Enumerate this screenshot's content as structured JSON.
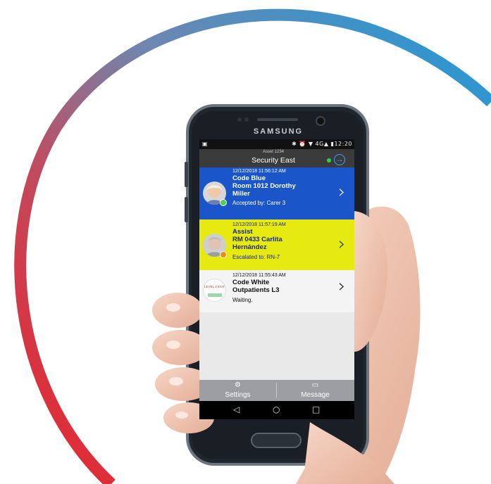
{
  "phone": {
    "brand": "SAMSUNG"
  },
  "status_bar": {
    "left_icon": "image-notification-icon",
    "right_text": "✱ ⏰ ▼ 4G▲ ▮12:20",
    "time": "12:20"
  },
  "app_bar": {
    "asset": "Asset 1234",
    "title": "Security East",
    "online_color": "#2dd34a"
  },
  "alerts": [
    {
      "time": "12/12/2018 11:56:12 AM",
      "line1": "Code Blue",
      "line2": "Room 1012 Dorothy",
      "line3": "Miller",
      "status": "Accepted by: Carer 3",
      "bg": "#1a56c9",
      "text_color": "#ffffff",
      "dot_color": "#4fd14b"
    },
    {
      "time": "12/12/2018 11:57:19 AM",
      "line1": "Assist",
      "line2": "RM 0433 Carlita",
      "line3": "Hernández",
      "status": "Escalated to: RN-7",
      "bg": "#e6ea11",
      "text_color": "#1a2a6b",
      "dot_color": "#f08a1c"
    },
    {
      "time": "12/12/2018 11:55:43 AM",
      "line1": "Code White",
      "line2": "Outpatients L3",
      "status": "Waiting.",
      "bg": "#f4f4f4",
      "text_color": "#111111",
      "thumb_text": "LEVEL 3 EXIT"
    }
  ],
  "tabs": [
    {
      "label": "Settings",
      "icon": "gears-icon"
    },
    {
      "label": "Message",
      "icon": "chat-icon"
    }
  ],
  "nav": {
    "back": "◁",
    "home": "○",
    "recents": "□"
  }
}
